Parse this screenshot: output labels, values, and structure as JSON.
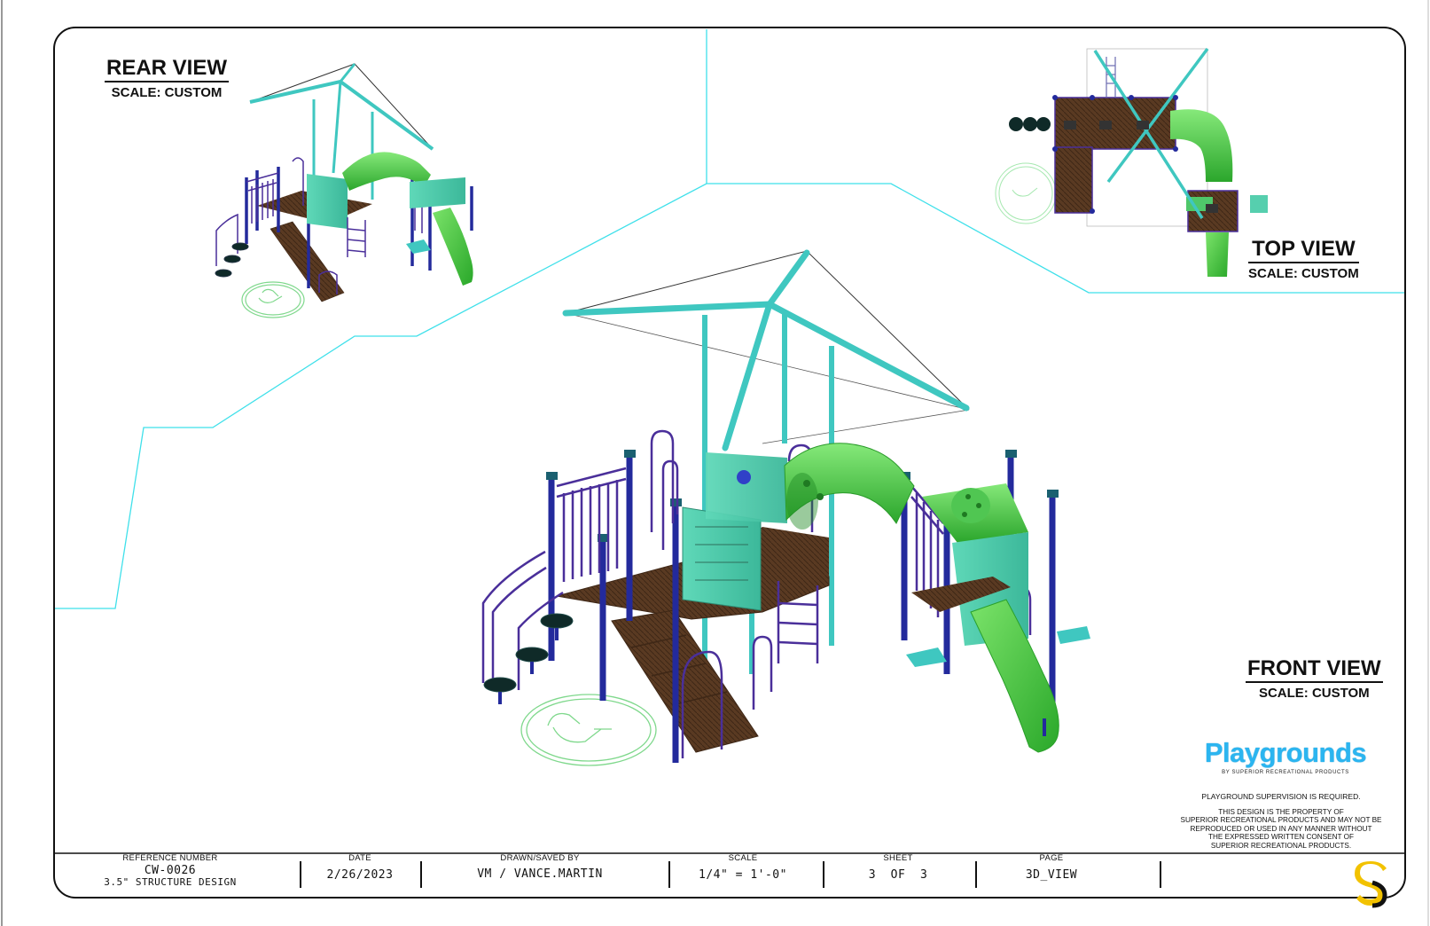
{
  "views": {
    "rear": {
      "title": "REAR VIEW",
      "scale": "SCALE: CUSTOM"
    },
    "top": {
      "title": "TOP VIEW",
      "scale": "SCALE: CUSTOM"
    },
    "front": {
      "title": "FRONT VIEW",
      "scale": "SCALE: CUSTOM"
    }
  },
  "brand": {
    "logo_text": "Playgrounds",
    "tagline": "BY SUPERIOR RECREATIONAL PRODUCTS"
  },
  "notes": {
    "supervision": "PLAYGROUND SUPERVISION IS REQUIRED.",
    "property_lines": [
      "THIS DESIGN IS THE PROPERTY OF",
      "SUPERIOR RECREATIONAL PRODUCTS AND MAY NOT BE",
      "REPRODUCED OR USED IN ANY MANNER WITHOUT",
      "THE EXPRESSED WRITTEN CONSENT OF",
      "SUPERIOR RECREATIONAL PRODUCTS."
    ]
  },
  "title_block": {
    "reference": {
      "label": "REFERENCE NUMBER",
      "value": "CW-0026",
      "detail": "3.5\"  STRUCTURE DESIGN"
    },
    "date": {
      "label": "DATE",
      "value": "2/26/2023"
    },
    "drawn": {
      "label": "DRAWN/SAVED BY",
      "value": "VM / VANCE.MARTIN"
    },
    "scale": {
      "label": "SCALE",
      "value": "1/4\" = 1'-0\""
    },
    "sheet": {
      "label": "SHEET",
      "value": "3  OF  3"
    },
    "page": {
      "label": "PAGE",
      "value": "3D_VIEW"
    }
  },
  "colors": {
    "border": "#111111",
    "guide_line": "#3fe0ea",
    "deck_brown": "#5a3a22",
    "post_blue": "#232a9c",
    "rail_purple": "#4a2f9a",
    "roof_teal": "#3fc7c0",
    "panel_teal": "#56cfae",
    "slide_green": "#3ec234",
    "ada_symbol": "#7fd88c",
    "brand_blue": "#2bb5f0",
    "brand_s_yellow": "#f2c200"
  },
  "icons": [
    "wheelchair-accessibility-icon",
    "superior-s-logo-icon"
  ]
}
